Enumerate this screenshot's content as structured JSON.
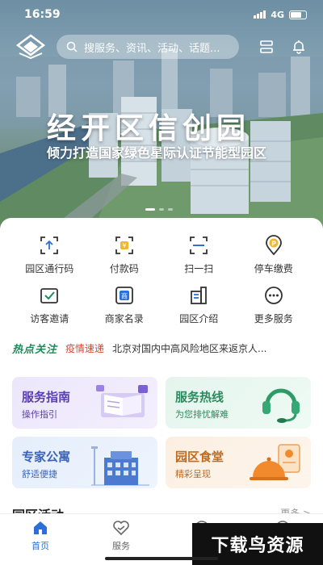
{
  "status_bar": {
    "time": "16:59",
    "network": "4G"
  },
  "header": {
    "search_placeholder": "搜服务、资讯、活动、话题...",
    "hero_title": "经开区信创园",
    "hero_subtitle": "倾力打造国家绿色星际认证节能型园区"
  },
  "services": [
    {
      "label": "园区通行码",
      "icon": "upload-scan-icon"
    },
    {
      "label": "付款码",
      "icon": "payment-code-icon"
    },
    {
      "label": "扫一扫",
      "icon": "scan-icon"
    },
    {
      "label": "停车缴费",
      "icon": "parking-icon"
    },
    {
      "label": "访客邀请",
      "icon": "visitor-invite-icon"
    },
    {
      "label": "商家名录",
      "icon": "merchant-icon"
    },
    {
      "label": "园区介绍",
      "icon": "park-intro-icon"
    },
    {
      "label": "更多服务",
      "icon": "more-icon"
    }
  ],
  "news": {
    "heading": "热点关注",
    "tag": "疫情速递",
    "text": "北京对国内中高风险地区来返京人..."
  },
  "cards": [
    {
      "title": "服务指南",
      "subtitle": "操作指引",
      "icon": "book-icon"
    },
    {
      "title": "服务热线",
      "subtitle": "为您排忧解难",
      "icon": "headset-icon"
    },
    {
      "title": "专家公寓",
      "subtitle": "舒适便捷",
      "icon": "building-icon"
    },
    {
      "title": "园区食堂",
      "subtitle": "精彩呈现",
      "icon": "food-icon"
    }
  ],
  "section": {
    "title": "园区活动",
    "more": "更多 >"
  },
  "tabs": [
    {
      "label": "首页",
      "icon": "home-icon",
      "active": true
    },
    {
      "label": "服务",
      "icon": "service-icon",
      "active": false
    },
    {
      "label": "",
      "icon": "compass-icon",
      "active": false
    },
    {
      "label": "",
      "icon": "profile-icon",
      "active": false
    }
  ],
  "watermark": "下载鸟资源",
  "colors": {
    "accent": "#2d6fd6",
    "hot": "#1f8a5b",
    "tag": "#e0432f"
  }
}
